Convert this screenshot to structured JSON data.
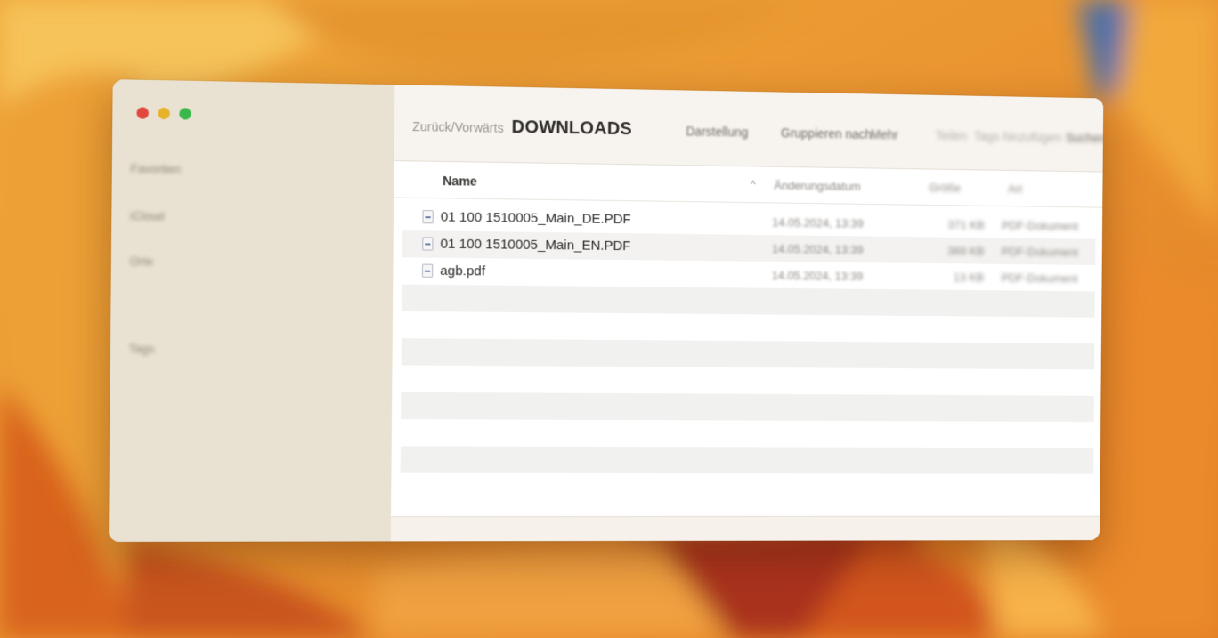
{
  "sidebar": {
    "window_controls": [
      "close",
      "minimize",
      "zoom"
    ],
    "items": [
      {
        "label": "Favoriten"
      },
      {
        "label": "iCloud"
      },
      {
        "label": "Orte"
      },
      {
        "label": "Tags"
      }
    ]
  },
  "toolbar": {
    "nav_label": "Zurück/Vorwärts",
    "title": "DOWNLOADS",
    "view_label": "Darstellung",
    "group_label": "Gruppieren nach",
    "more_label": "Mehr",
    "share_label": "Teilen",
    "tags_label": "Tags hinzufügen",
    "search_label": "Suchen"
  },
  "columns": {
    "name": "Name",
    "sort_indicator": "^",
    "date": "Änderungsdatum",
    "size": "Größe",
    "kind": "Art"
  },
  "files": [
    {
      "name": "01 100 1510005_Main_DE.PDF",
      "date": "14.05.2024, 13:39",
      "size": "371 KB",
      "kind": "PDF-Dokument",
      "icon": "pdf-document-icon"
    },
    {
      "name": "01 100 1510005_Main_EN.PDF",
      "date": "14.05.2024, 13:39",
      "size": "369 KB",
      "kind": "PDF-Dokument",
      "icon": "pdf-document-icon"
    },
    {
      "name": "agb.pdf",
      "date": "14.05.2024, 13:39",
      "size": "13 KB",
      "kind": "PDF-Dokument",
      "icon": "pdf-document-icon"
    }
  ],
  "colors": {
    "sidebar_bg": "#e9e2d2",
    "toolbar_bg": "#f7f3ef",
    "wallpaper_orange": "#e8912f",
    "close_red": "#e0473f",
    "minimize_yellow": "#e8b32c",
    "zoom_green": "#39b84b"
  }
}
